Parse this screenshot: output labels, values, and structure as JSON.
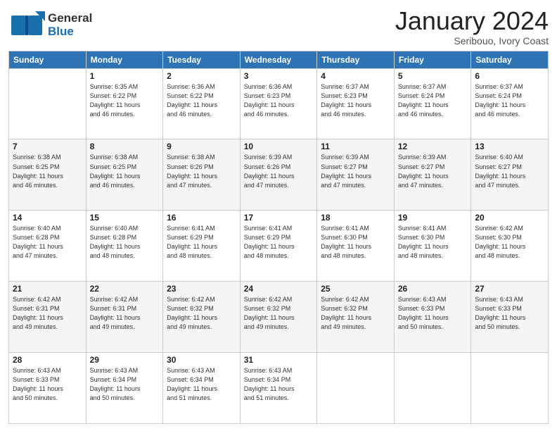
{
  "logo": {
    "general": "General",
    "blue": "Blue"
  },
  "header": {
    "month": "January 2024",
    "location": "Seribouo, Ivory Coast"
  },
  "weekdays": [
    "Sunday",
    "Monday",
    "Tuesday",
    "Wednesday",
    "Thursday",
    "Friday",
    "Saturday"
  ],
  "weeks": [
    [
      {
        "day": "",
        "info": ""
      },
      {
        "day": "1",
        "info": "Sunrise: 6:35 AM\nSunset: 6:22 PM\nDaylight: 11 hours\nand 46 minutes."
      },
      {
        "day": "2",
        "info": "Sunrise: 6:36 AM\nSunset: 6:22 PM\nDaylight: 11 hours\nand 46 minutes."
      },
      {
        "day": "3",
        "info": "Sunrise: 6:36 AM\nSunset: 6:23 PM\nDaylight: 11 hours\nand 46 minutes."
      },
      {
        "day": "4",
        "info": "Sunrise: 6:37 AM\nSunset: 6:23 PM\nDaylight: 11 hours\nand 46 minutes."
      },
      {
        "day": "5",
        "info": "Sunrise: 6:37 AM\nSunset: 6:24 PM\nDaylight: 11 hours\nand 46 minutes."
      },
      {
        "day": "6",
        "info": "Sunrise: 6:37 AM\nSunset: 6:24 PM\nDaylight: 11 hours\nand 46 minutes."
      }
    ],
    [
      {
        "day": "7",
        "info": "Sunrise: 6:38 AM\nSunset: 6:25 PM\nDaylight: 11 hours\nand 46 minutes."
      },
      {
        "day": "8",
        "info": "Sunrise: 6:38 AM\nSunset: 6:25 PM\nDaylight: 11 hours\nand 46 minutes."
      },
      {
        "day": "9",
        "info": "Sunrise: 6:38 AM\nSunset: 6:26 PM\nDaylight: 11 hours\nand 47 minutes."
      },
      {
        "day": "10",
        "info": "Sunrise: 6:39 AM\nSunset: 6:26 PM\nDaylight: 11 hours\nand 47 minutes."
      },
      {
        "day": "11",
        "info": "Sunrise: 6:39 AM\nSunset: 6:27 PM\nDaylight: 11 hours\nand 47 minutes."
      },
      {
        "day": "12",
        "info": "Sunrise: 6:39 AM\nSunset: 6:27 PM\nDaylight: 11 hours\nand 47 minutes."
      },
      {
        "day": "13",
        "info": "Sunrise: 6:40 AM\nSunset: 6:27 PM\nDaylight: 11 hours\nand 47 minutes."
      }
    ],
    [
      {
        "day": "14",
        "info": "Sunrise: 6:40 AM\nSunset: 6:28 PM\nDaylight: 11 hours\nand 47 minutes."
      },
      {
        "day": "15",
        "info": "Sunrise: 6:40 AM\nSunset: 6:28 PM\nDaylight: 11 hours\nand 48 minutes."
      },
      {
        "day": "16",
        "info": "Sunrise: 6:41 AM\nSunset: 6:29 PM\nDaylight: 11 hours\nand 48 minutes."
      },
      {
        "day": "17",
        "info": "Sunrise: 6:41 AM\nSunset: 6:29 PM\nDaylight: 11 hours\nand 48 minutes."
      },
      {
        "day": "18",
        "info": "Sunrise: 6:41 AM\nSunset: 6:30 PM\nDaylight: 11 hours\nand 48 minutes."
      },
      {
        "day": "19",
        "info": "Sunrise: 6:41 AM\nSunset: 6:30 PM\nDaylight: 11 hours\nand 48 minutes."
      },
      {
        "day": "20",
        "info": "Sunrise: 6:42 AM\nSunset: 6:30 PM\nDaylight: 11 hours\nand 48 minutes."
      }
    ],
    [
      {
        "day": "21",
        "info": "Sunrise: 6:42 AM\nSunset: 6:31 PM\nDaylight: 11 hours\nand 49 minutes."
      },
      {
        "day": "22",
        "info": "Sunrise: 6:42 AM\nSunset: 6:31 PM\nDaylight: 11 hours\nand 49 minutes."
      },
      {
        "day": "23",
        "info": "Sunrise: 6:42 AM\nSunset: 6:32 PM\nDaylight: 11 hours\nand 49 minutes."
      },
      {
        "day": "24",
        "info": "Sunrise: 6:42 AM\nSunset: 6:32 PM\nDaylight: 11 hours\nand 49 minutes."
      },
      {
        "day": "25",
        "info": "Sunrise: 6:42 AM\nSunset: 6:32 PM\nDaylight: 11 hours\nand 49 minutes."
      },
      {
        "day": "26",
        "info": "Sunrise: 6:43 AM\nSunset: 6:33 PM\nDaylight: 11 hours\nand 50 minutes."
      },
      {
        "day": "27",
        "info": "Sunrise: 6:43 AM\nSunset: 6:33 PM\nDaylight: 11 hours\nand 50 minutes."
      }
    ],
    [
      {
        "day": "28",
        "info": "Sunrise: 6:43 AM\nSunset: 6:33 PM\nDaylight: 11 hours\nand 50 minutes."
      },
      {
        "day": "29",
        "info": "Sunrise: 6:43 AM\nSunset: 6:34 PM\nDaylight: 11 hours\nand 50 minutes."
      },
      {
        "day": "30",
        "info": "Sunrise: 6:43 AM\nSunset: 6:34 PM\nDaylight: 11 hours\nand 51 minutes."
      },
      {
        "day": "31",
        "info": "Sunrise: 6:43 AM\nSunset: 6:34 PM\nDaylight: 11 hours\nand 51 minutes."
      },
      {
        "day": "",
        "info": ""
      },
      {
        "day": "",
        "info": ""
      },
      {
        "day": "",
        "info": ""
      }
    ]
  ]
}
